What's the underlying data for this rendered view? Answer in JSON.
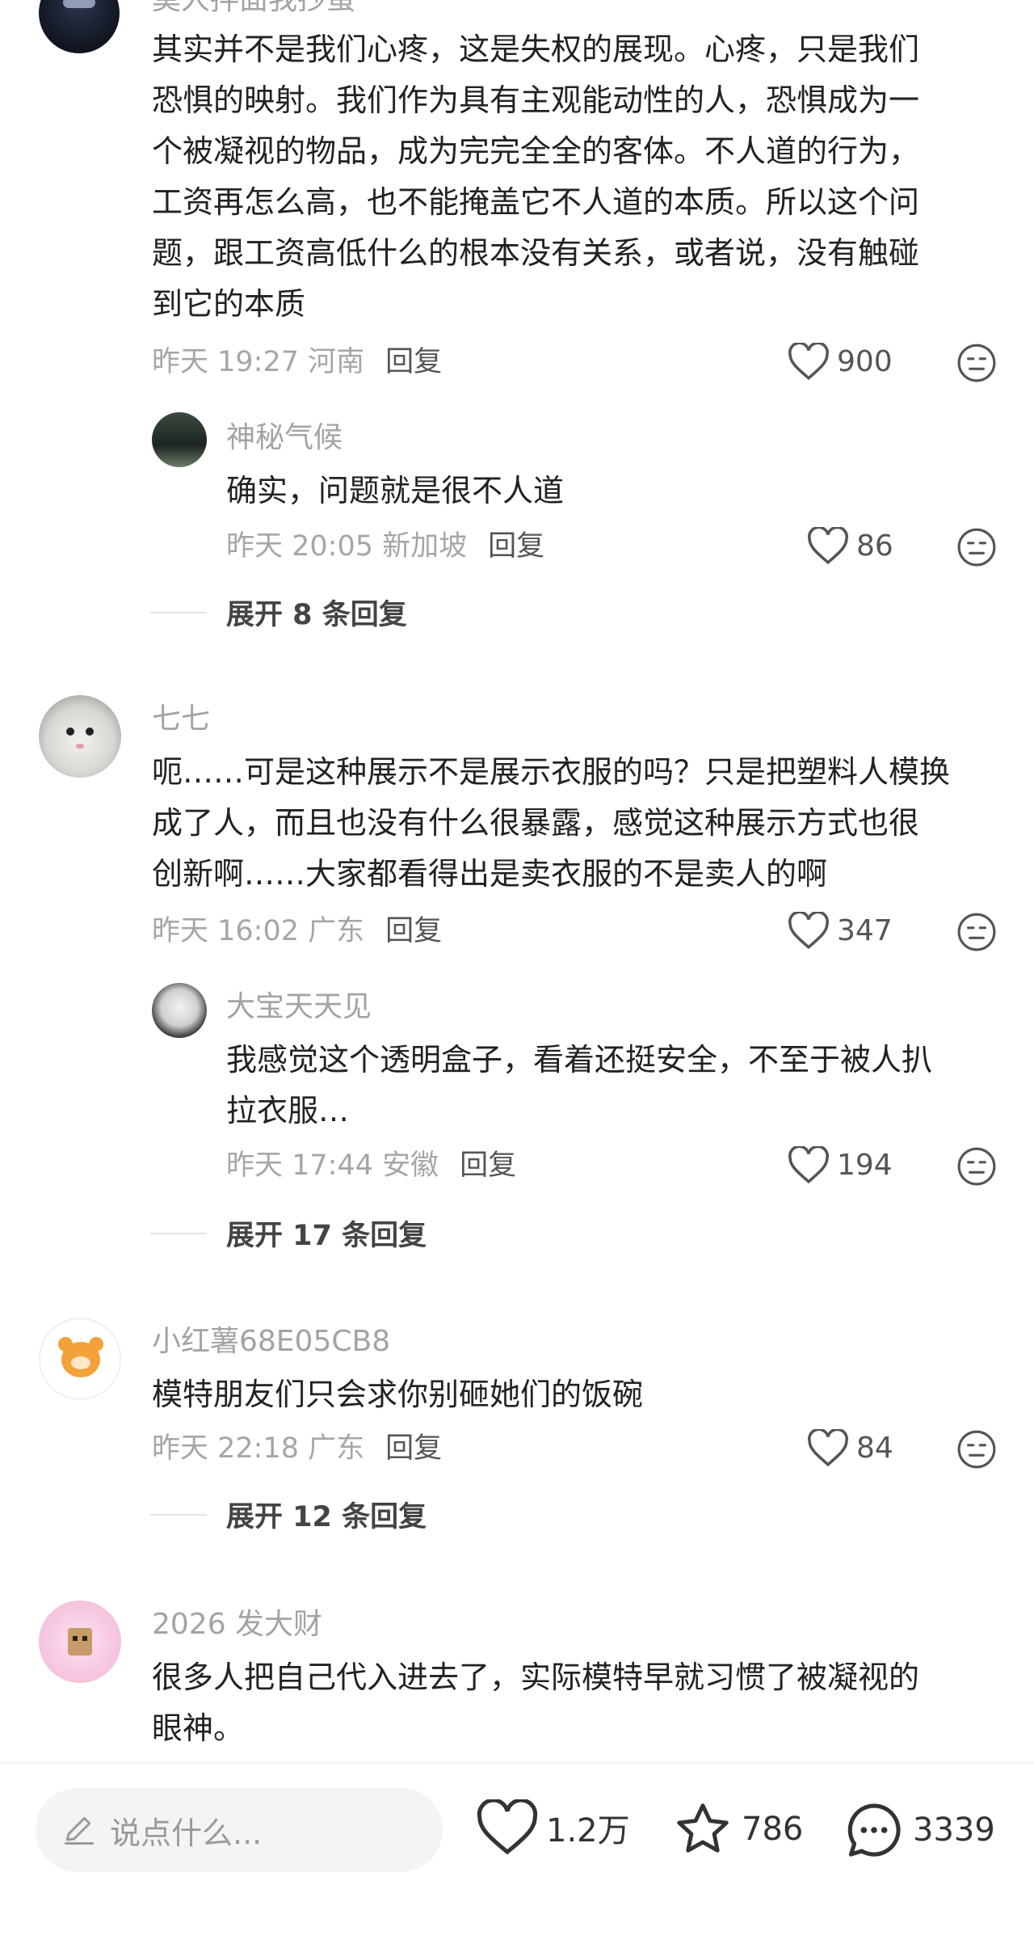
{
  "comments": [
    {
      "name": "莫人拌面我抄蛋",
      "text_lines": [
        "其实并不是我们心疼，这是失权的展现。心疼，只是我们",
        "恐惧的映射。我们作为具有主观能动性的人，恐惧成为一",
        "个被凝视的物品，成为完完全全的客体。不人道的行为，",
        "工资再怎么高，也不能掩盖它不人道的本质。所以这个问",
        "题，跟工资高低什么的根本没有关系，或者说，没有触碰",
        "到它的本质"
      ],
      "time": "昨天 19:27 河南",
      "reply": "回复",
      "likes": "900",
      "sub": {
        "name": "神秘气候",
        "text_lines": [
          "确实，问题就是很不人道"
        ],
        "time": "昨天 20:05 新加坡",
        "reply": "回复",
        "likes": "86"
      },
      "expand": "展开 8 条回复"
    },
    {
      "name": "七七",
      "text_lines": [
        "呃……可是这种展示不是展示衣服的吗？只是把塑料人模换",
        "成了人，而且也没有什么很暴露，感觉这种展示方式也很",
        "创新啊……大家都看得出是卖衣服的不是卖人的啊"
      ],
      "time": "昨天 16:02 广东",
      "reply": "回复",
      "likes": "347",
      "sub": {
        "name": "大宝天天见",
        "text_lines": [
          "我感觉这个透明盒子，看着还挺安全，不至于被人扒",
          "拉衣服…"
        ],
        "time": "昨天 17:44 安徽",
        "reply": "回复",
        "likes": "194"
      },
      "expand": "展开 17 条回复"
    },
    {
      "name": "小红薯68E05CB8",
      "text_lines": [
        "模特朋友们只会求你别砸她们的饭碗"
      ],
      "time": "昨天 22:18 广东",
      "reply": "回复",
      "likes": "84",
      "expand": "展开 12 条回复"
    },
    {
      "name": "2026 发大财",
      "text_lines": [
        "很多人把自己代入进去了，实际模特早就习惯了被凝视的",
        "眼神。"
      ]
    }
  ],
  "bottom_bar": {
    "placeholder": "说点什么...",
    "like_count": "1.2万",
    "star_count": "786",
    "comment_count": "3339"
  },
  "icons": {
    "like": "heart-icon",
    "dislike": "unhappy-face-icon",
    "edit": "pencil-icon",
    "star": "star-icon",
    "comment": "chat-bubble-icon"
  }
}
